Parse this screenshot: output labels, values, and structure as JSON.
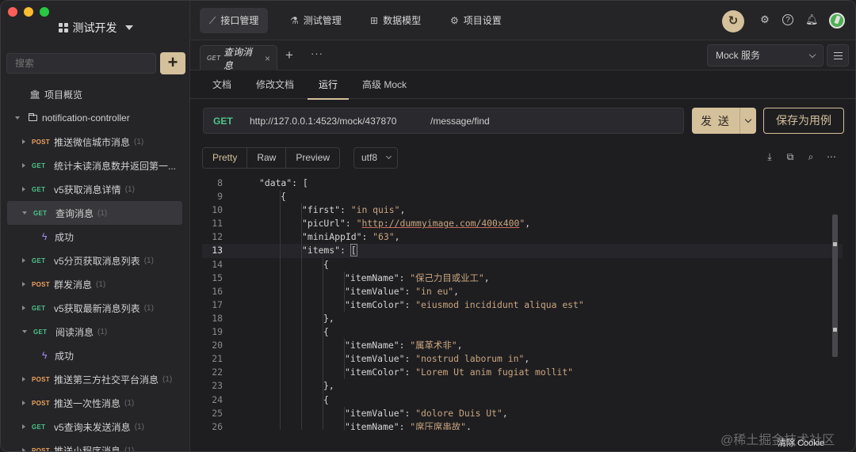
{
  "window": {
    "traffic_lights": [
      "close",
      "minimize",
      "zoom"
    ]
  },
  "sidebar": {
    "project_name": "测试开发",
    "search_placeholder": "搜索",
    "add_label": "+",
    "tree": [
      {
        "kind": "overview",
        "label": "项目概览"
      },
      {
        "kind": "folder",
        "label": "notification-controller",
        "expanded": true
      },
      {
        "kind": "api",
        "method": "POST",
        "label": "推送微信城市消息",
        "count": "(1)"
      },
      {
        "kind": "api",
        "method": "GET",
        "label": "统计未读消息数并返回第一...",
        "count": ""
      },
      {
        "kind": "api",
        "method": "GET",
        "label": "v5获取消息详情",
        "count": "(1)"
      },
      {
        "kind": "api",
        "method": "GET",
        "label": "查询消息",
        "count": "(1)",
        "selected": true,
        "expanded": true
      },
      {
        "kind": "case",
        "label": "成功"
      },
      {
        "kind": "api",
        "method": "GET",
        "label": "v5分页获取消息列表",
        "count": "(1)"
      },
      {
        "kind": "api",
        "method": "POST",
        "label": "群发消息",
        "count": "(1)"
      },
      {
        "kind": "api",
        "method": "GET",
        "label": "v5获取最新消息列表",
        "count": "(1)"
      },
      {
        "kind": "api",
        "method": "GET",
        "label": "阅读消息",
        "count": "(1)",
        "expanded": true
      },
      {
        "kind": "case",
        "label": "成功"
      },
      {
        "kind": "api",
        "method": "POST",
        "label": "推送第三方社交平台消息",
        "count": "(1)"
      },
      {
        "kind": "api",
        "method": "POST",
        "label": "推送一次性消息",
        "count": "(1)"
      },
      {
        "kind": "api",
        "method": "GET",
        "label": "v5查询未发送消息",
        "count": "(1)"
      },
      {
        "kind": "api",
        "method": "POST",
        "label": "推送小程序消息",
        "count": "(1)"
      }
    ]
  },
  "topbar": {
    "tabs": [
      {
        "label": "接口管理",
        "icon": "rocket-icon",
        "active": true
      },
      {
        "label": "测试管理",
        "icon": "flask-icon"
      },
      {
        "label": "数据模型",
        "icon": "model-icon"
      },
      {
        "label": "项目设置",
        "icon": "gear-icon"
      }
    ],
    "icons": [
      "sync-icon",
      "settings-icon",
      "help-icon",
      "bell-icon",
      "avatar"
    ]
  },
  "tabstrip": {
    "open_tab": {
      "method": "GET",
      "title": "查询消息",
      "close": "×"
    },
    "plus": "+",
    "more": "···",
    "environment": "Mock 服务"
  },
  "subtabs": [
    "文档",
    "修改文档",
    "运行",
    "高级 Mock"
  ],
  "active_subtab": "运行",
  "request": {
    "method": "GET",
    "base_url": "http://127.0.0.1:4523/mock/437870",
    "path": "/message/find",
    "send_label": "发 送",
    "save_label": "保存为用例"
  },
  "response_toolbar": {
    "formats": [
      "Pretty",
      "Raw",
      "Preview"
    ],
    "active_format": "Pretty",
    "encoding": "utf8",
    "tools": [
      "download-icon",
      "copy-icon",
      "search-icon",
      "more-icon"
    ]
  },
  "code": {
    "current_line": 13,
    "lines": [
      {
        "n": "8",
        "indent": 2,
        "tokens": [
          [
            "k",
            "\"data\""
          ],
          [
            "p",
            ": ["
          ]
        ]
      },
      {
        "n": "9",
        "indent": 3,
        "tokens": [
          [
            "p",
            "{"
          ]
        ]
      },
      {
        "n": "10",
        "indent": 4,
        "tokens": [
          [
            "k",
            "\"first\""
          ],
          [
            "p",
            ": "
          ],
          [
            "s",
            "\"in quis\""
          ],
          [
            "p",
            ","
          ]
        ]
      },
      {
        "n": "11",
        "indent": 4,
        "tokens": [
          [
            "k",
            "\"picUrl\""
          ],
          [
            "p",
            ": "
          ],
          [
            "s",
            "\"http://dummyimage.com/400x400\""
          ],
          [
            "p",
            ","
          ]
        ]
      },
      {
        "n": "12",
        "indent": 4,
        "tokens": [
          [
            "k",
            "\"miniAppId\""
          ],
          [
            "p",
            ": "
          ],
          [
            "s",
            "\"63\""
          ],
          [
            "p",
            ","
          ]
        ]
      },
      {
        "n": "13",
        "indent": 4,
        "tokens": [
          [
            "k",
            "\"items\""
          ],
          [
            "p",
            ": "
          ],
          [
            "b",
            "["
          ]
        ]
      },
      {
        "n": "14",
        "indent": 5,
        "tokens": [
          [
            "p",
            "{"
          ]
        ]
      },
      {
        "n": "15",
        "indent": 6,
        "tokens": [
          [
            "k",
            "\"itemName\""
          ],
          [
            "p",
            ": "
          ],
          [
            "s",
            "\"保己力目或业工\""
          ],
          [
            "p",
            ","
          ]
        ]
      },
      {
        "n": "16",
        "indent": 6,
        "tokens": [
          [
            "k",
            "\"itemValue\""
          ],
          [
            "p",
            ": "
          ],
          [
            "s",
            "\"in eu\""
          ],
          [
            "p",
            ","
          ]
        ]
      },
      {
        "n": "17",
        "indent": 6,
        "tokens": [
          [
            "k",
            "\"itemColor\""
          ],
          [
            "p",
            ": "
          ],
          [
            "s",
            "\"eiusmod incididunt aliqua est\""
          ]
        ]
      },
      {
        "n": "18",
        "indent": 5,
        "tokens": [
          [
            "p",
            "},"
          ]
        ]
      },
      {
        "n": "19",
        "indent": 5,
        "tokens": [
          [
            "p",
            "{"
          ]
        ]
      },
      {
        "n": "20",
        "indent": 6,
        "tokens": [
          [
            "k",
            "\"itemName\""
          ],
          [
            "p",
            ": "
          ],
          [
            "s",
            "\"属革术非\""
          ],
          [
            "p",
            ","
          ]
        ]
      },
      {
        "n": "21",
        "indent": 6,
        "tokens": [
          [
            "k",
            "\"itemValue\""
          ],
          [
            "p",
            ": "
          ],
          [
            "s",
            "\"nostrud laborum in\""
          ],
          [
            "p",
            ","
          ]
        ]
      },
      {
        "n": "22",
        "indent": 6,
        "tokens": [
          [
            "k",
            "\"itemColor\""
          ],
          [
            "p",
            ": "
          ],
          [
            "s",
            "\"Lorem Ut anim fugiat mollit\""
          ]
        ]
      },
      {
        "n": "23",
        "indent": 5,
        "tokens": [
          [
            "p",
            "},"
          ]
        ]
      },
      {
        "n": "24",
        "indent": 5,
        "tokens": [
          [
            "p",
            "{"
          ]
        ]
      },
      {
        "n": "25",
        "indent": 6,
        "tokens": [
          [
            "k",
            "\"itemValue\""
          ],
          [
            "p",
            ": "
          ],
          [
            "s",
            "\"dolore Duis Ut\""
          ],
          [
            "p",
            ","
          ]
        ]
      },
      {
        "n": "26",
        "indent": 6,
        "tokens": [
          [
            "k",
            "\"itemName\""
          ],
          [
            "p",
            ": "
          ],
          [
            "s",
            "\"席压席串故\""
          ],
          [
            "p",
            ","
          ]
        ]
      }
    ]
  },
  "overlay": {
    "watermark": "@稀土掘金技术社区",
    "cookie_tag": "清除 Cookie"
  },
  "colors": {
    "accent": "#d4c09a",
    "get": "#4cc38a",
    "post": "#f0a35b",
    "string": "#c9a57e",
    "case_bolt": "#a78bfa"
  }
}
